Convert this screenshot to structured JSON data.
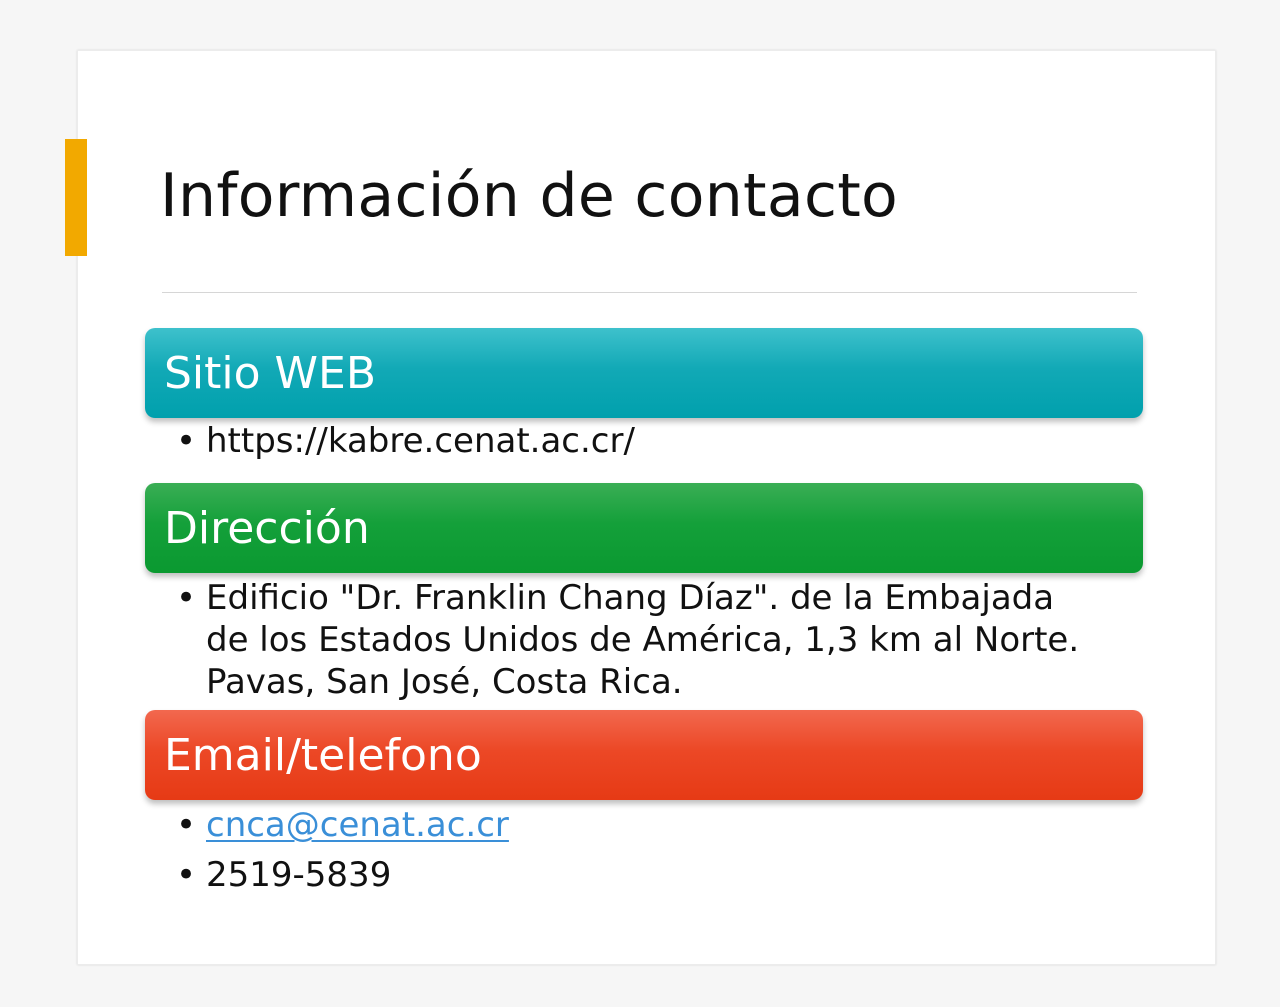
{
  "slide": {
    "title": "Información de contacto",
    "accent_color": "#f2a900",
    "sections": [
      {
        "header": "Sitio WEB",
        "color": "#00a0ad",
        "items": [
          "https://kabre.cenat.ac.cr/"
        ]
      },
      {
        "header": "Dirección",
        "color": "#0a9930",
        "items": [
          "Edificio \"Dr. Franklin Chang Díaz\". de la Embajada de los Estados Unidos de América, 1,3 km al Norte. Pavas, San José, Costa Rica."
        ]
      },
      {
        "header": "Email/telefono",
        "color": "#e63a15",
        "items": [
          "cnca@cenat.ac.cr",
          "2519-5839"
        ]
      }
    ],
    "bullet_glyph": "•"
  }
}
